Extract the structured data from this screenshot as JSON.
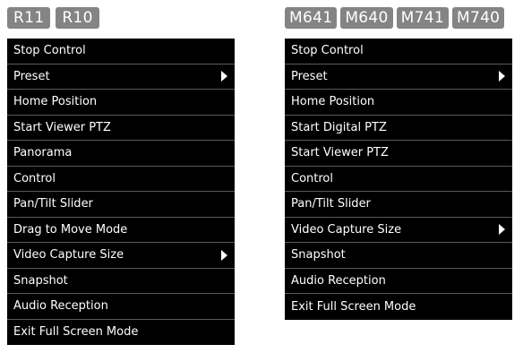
{
  "left": {
    "models": [
      "R11",
      "R10"
    ],
    "items": [
      {
        "label": "Stop Control",
        "submenu": false
      },
      {
        "label": "Preset",
        "submenu": true
      },
      {
        "label": "Home Position",
        "submenu": false
      },
      {
        "label": "Start Viewer PTZ",
        "submenu": false
      },
      {
        "label": "Panorama",
        "submenu": false
      },
      {
        "label": "Control",
        "submenu": false
      },
      {
        "label": "Pan/Tilt Slider",
        "submenu": false
      },
      {
        "label": "Drag to Move Mode",
        "submenu": false
      },
      {
        "label": "Video Capture Size",
        "submenu": true
      },
      {
        "label": "Snapshot",
        "submenu": false
      },
      {
        "label": "Audio Reception",
        "submenu": false
      },
      {
        "label": "Exit Full Screen Mode",
        "submenu": false
      }
    ]
  },
  "right": {
    "models": [
      "M641",
      "M640",
      "M741",
      "M740"
    ],
    "items": [
      {
        "label": "Stop Control",
        "submenu": false
      },
      {
        "label": "Preset",
        "submenu": true
      },
      {
        "label": "Home Position",
        "submenu": false
      },
      {
        "label": "Start Digital PTZ",
        "submenu": false
      },
      {
        "label": "Start Viewer PTZ",
        "submenu": false
      },
      {
        "label": "Control",
        "submenu": false
      },
      {
        "label": "Pan/Tilt Slider",
        "submenu": false
      },
      {
        "label": "Video Capture Size",
        "submenu": true
      },
      {
        "label": "Snapshot",
        "submenu": false
      },
      {
        "label": "Audio Reception",
        "submenu": false
      },
      {
        "label": "Exit Full Screen Mode",
        "submenu": false
      }
    ]
  },
  "colors": {
    "menu_bg": "#000000",
    "badge_bg": "#848484",
    "text": "#ffffff"
  },
  "icons": {
    "submenu": "triangle-right-icon"
  }
}
